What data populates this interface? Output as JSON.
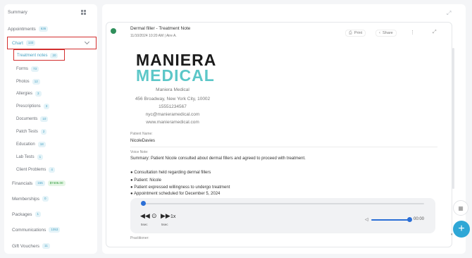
{
  "sidebar": {
    "summary_label": "Summary",
    "items": [
      {
        "label": "Appointments",
        "count": "636"
      },
      {
        "label": "Chart",
        "count": "133"
      },
      {
        "label": "Financials",
        "count": "155",
        "amount": "$7405.00"
      },
      {
        "label": "Memberships",
        "count": "0"
      },
      {
        "label": "Packages",
        "count": "1"
      },
      {
        "label": "Communications",
        "count": "1053"
      },
      {
        "label": "Gift Vouchers",
        "count": "11"
      }
    ],
    "chart_sub": [
      {
        "label": "Treatment notes",
        "count": "20"
      },
      {
        "label": "Forms",
        "count": "73"
      },
      {
        "label": "Photos",
        "count": "12"
      },
      {
        "label": "Allergies",
        "count": "3"
      },
      {
        "label": "Prescriptions",
        "count": "3"
      },
      {
        "label": "Documents",
        "count": "10"
      },
      {
        "label": "Patch Tests",
        "count": "2"
      },
      {
        "label": "Education",
        "count": "18"
      },
      {
        "label": "Lab Tests",
        "count": "1"
      },
      {
        "label": "Client Problems",
        "count": "4"
      }
    ]
  },
  "note": {
    "title": "Dermal filler - Treatment Note",
    "meta": "11/10/2024 10:20 AM | Aire A.",
    "print_label": "Print",
    "share_label": "Share"
  },
  "clinic": {
    "logo_line1": "MANIERA",
    "logo_line2": "MEDICAL",
    "name": "Maniera Medical",
    "address": "456 Broadway, New York City, 10002",
    "phone": "15551234567",
    "email": "nyc@manieramedical.com",
    "website": "www.manieramedical.com"
  },
  "patient": {
    "label": "Patient Name:",
    "name": "NicoleDavies"
  },
  "voice": {
    "label": "Voice Note:",
    "summary": "Summary: Patient Nicole consulted about dermal fillers and agreed to proceed with treatment.",
    "bullets": [
      "● Consultation held regarding dermal fillers",
      "● Patient: Nicole",
      "● Patient expressed willingness to undergo treatment",
      "● Appointment scheduled for December 5, 2024"
    ]
  },
  "player": {
    "progress": 0,
    "back_label": "5sec",
    "forward_label": "5sec",
    "speed": "1x",
    "volume": 1,
    "time": "00:00"
  },
  "practitioner_label": "Practitioner:",
  "colors": {
    "accent": "#2fa7d6",
    "badge_text": "#4aa3c4",
    "highlight_border": "#d32f2f",
    "logo_teal": "#5cc7c8",
    "player_blue": "#2b6fd6"
  }
}
